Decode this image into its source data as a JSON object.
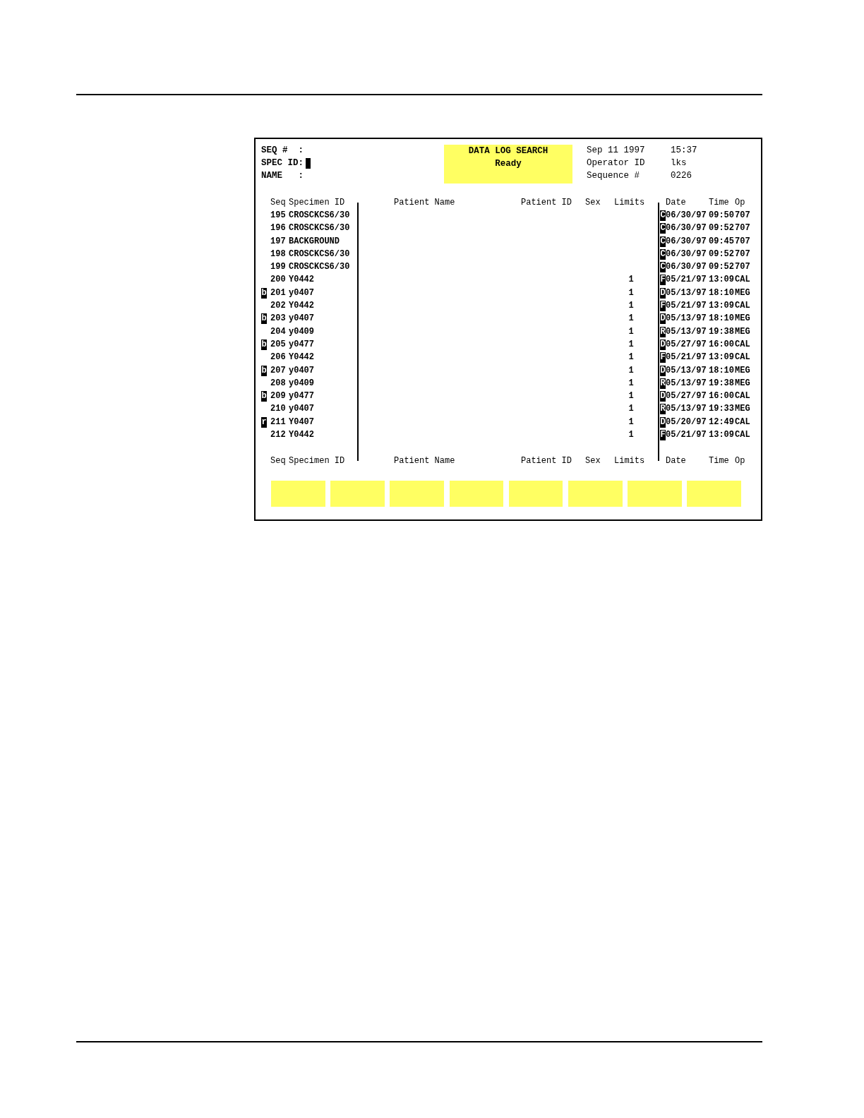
{
  "header": {
    "fields": [
      {
        "label": "SEQ #  :",
        "focused": false
      },
      {
        "label": "SPEC ID:",
        "focused": true
      },
      {
        "label": "NAME   :",
        "focused": false
      }
    ],
    "title": "DATA LOG SEARCH",
    "status": "Ready",
    "info": [
      {
        "label": "Sep 11 1997",
        "value": "15:37"
      },
      {
        "label": "Operator ID",
        "value": "lks"
      },
      {
        "label": "Sequence #",
        "value": "0226"
      }
    ]
  },
  "table": {
    "columns": [
      "Seq",
      "Specimen ID",
      "Patient Name",
      "Patient ID",
      "Sex",
      "Limits",
      "Date",
      "Time",
      "Op"
    ],
    "rows": [
      {
        "seq": "195",
        "specimen_id": "CROSCKCS6/30",
        "flag": "C",
        "date": "06/30/97",
        "time": "09:50",
        "op": "707"
      },
      {
        "seq": "196",
        "specimen_id": "CROSCKCS6/30",
        "flag": "C",
        "date": "06/30/97",
        "time": "09:52",
        "op": "707"
      },
      {
        "seq": "197",
        "specimen_id": "BACKGROUND",
        "flag": "C",
        "date": "06/30/97",
        "time": "09:45",
        "op": "707"
      },
      {
        "seq": "198",
        "specimen_id": "CROSCKCS6/30",
        "flag": "C",
        "date": "06/30/97",
        "time": "09:52",
        "op": "707"
      },
      {
        "seq": "199",
        "specimen_id": "CROSCKCS6/30",
        "flag": "C",
        "date": "06/30/97",
        "time": "09:52",
        "op": "707"
      },
      {
        "seq": "200",
        "specimen_id": "Y0442",
        "limits": "1",
        "flag": "F",
        "date": "05/21/97",
        "time": "13:09",
        "op": "CAL"
      },
      {
        "mark": "b",
        "seq": "201",
        "specimen_id": "y0407",
        "limits": "1",
        "flag": "D",
        "date": "05/13/97",
        "time": "18:10",
        "op": "MEG"
      },
      {
        "seq": "202",
        "specimen_id": "Y0442",
        "limits": "1",
        "flag": "F",
        "date": "05/21/97",
        "time": "13:09",
        "op": "CAL"
      },
      {
        "mark": "b",
        "seq": "203",
        "specimen_id": "y0407",
        "limits": "1",
        "flag": "D",
        "date": "05/13/97",
        "time": "18:10",
        "op": "MEG"
      },
      {
        "seq": "204",
        "specimen_id": "y0409",
        "limits": "1",
        "flag": "R",
        "date": "05/13/97",
        "time": "19:38",
        "op": "MEG"
      },
      {
        "mark": "b",
        "seq": "205",
        "specimen_id": "y0477",
        "limits": "1",
        "flag": "D",
        "date": "05/27/97",
        "time": "16:00",
        "op": "CAL"
      },
      {
        "seq": "206",
        "specimen_id": "Y0442",
        "limits": "1",
        "flag": "F",
        "date": "05/21/97",
        "time": "13:09",
        "op": "CAL"
      },
      {
        "mark": "b",
        "seq": "207",
        "specimen_id": "y0407",
        "limits": "1",
        "flag": "D",
        "date": "05/13/97",
        "time": "18:10",
        "op": "MEG"
      },
      {
        "seq": "208",
        "specimen_id": "y0409",
        "limits": "1",
        "flag": "R",
        "date": "05/13/97",
        "time": "19:38",
        "op": "MEG"
      },
      {
        "mark": "b",
        "seq": "209",
        "specimen_id": "y0477",
        "limits": "1",
        "flag": "D",
        "date": "05/27/97",
        "time": "16:00",
        "op": "CAL"
      },
      {
        "seq": "210",
        "specimen_id": "y0407",
        "limits": "1",
        "flag": "R",
        "date": "05/13/97",
        "time": "19:33",
        "op": "MEG"
      },
      {
        "mark": "r",
        "seq": "211",
        "specimen_id": "Y0407",
        "limits": "1",
        "flag": "D",
        "date": "05/20/97",
        "time": "12:49",
        "op": "CAL"
      },
      {
        "seq": "212",
        "specimen_id": "Y0442",
        "limits": "1",
        "flag": "F",
        "date": "05/21/97",
        "time": "13:09",
        "op": "CAL"
      }
    ],
    "footer_columns": [
      "Seq",
      "Specimen ID",
      "Patient Name",
      "Patient ID",
      "Sex",
      "Limits",
      "Date",
      "Time",
      "Op"
    ]
  }
}
